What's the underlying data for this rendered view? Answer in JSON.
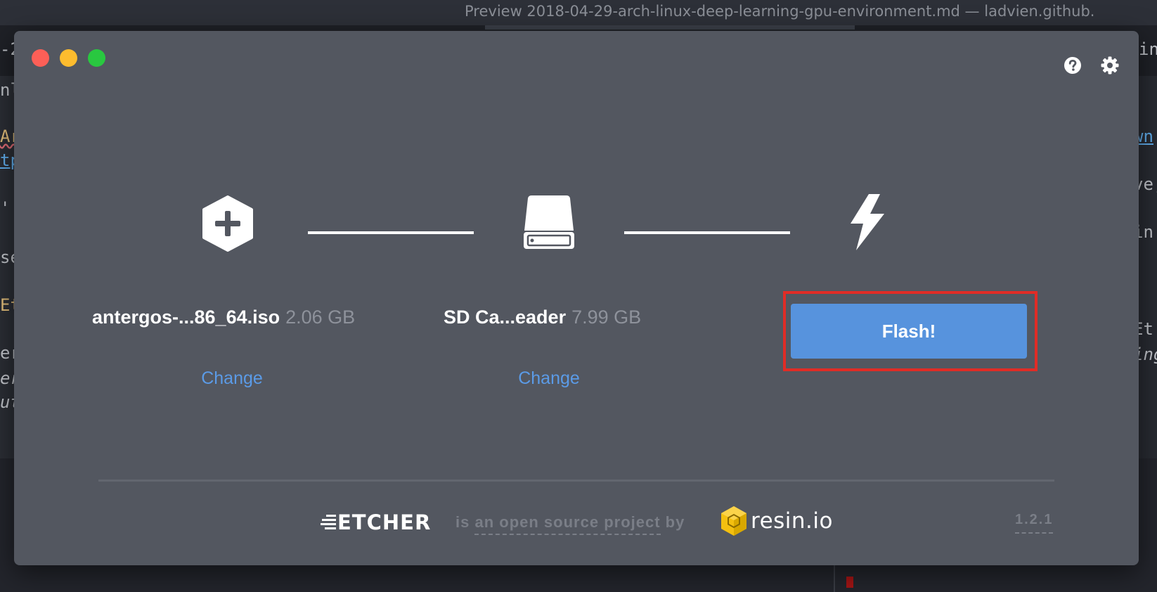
{
  "background_window": {
    "title": "Preview 2018-04-29-arch-linux-deep-learning-gpu-environment.md — ladvien.github.",
    "fragments": {
      "tab_left": "-2",
      "tab_right": "in",
      "l1": "nl",
      "l2": "Ar",
      "l3": "tp",
      "l4": "''",
      "l5": "se",
      "l6": "Et",
      "l7": "er",
      "l8": "er",
      "l9": "ut",
      "r1": "wn",
      "r2": "ve,",
      "r3": "in",
      "r4": "Et",
      "r5": "ing"
    }
  },
  "app": {
    "name": "Etcher",
    "steps": {
      "image": {
        "icon": "add-image-hexagon-icon",
        "filename": "antergos-...86_64.iso",
        "size": "2.06 GB",
        "change_label": "Change"
      },
      "drive": {
        "icon": "drive-icon",
        "name": "SD Ca...eader",
        "size": "7.99 GB",
        "change_label": "Change"
      },
      "flash": {
        "icon": "lightning-bolt-icon",
        "button_label": "Flash!"
      }
    },
    "header_icons": [
      "help-icon",
      "gear-icon"
    ],
    "footer": {
      "logo_text": "ETCHER",
      "text_prefix": "is",
      "text_dotted": "an open source project",
      "text_suffix": "by",
      "partner_logo_text": "resin.io",
      "version": "1.2.1"
    },
    "colors": {
      "window_bg": "#535760",
      "accent_blue": "#5793dd",
      "link_blue": "#5b9be7",
      "highlight_red": "#e12c26",
      "muted_text": "#8e929b"
    }
  }
}
